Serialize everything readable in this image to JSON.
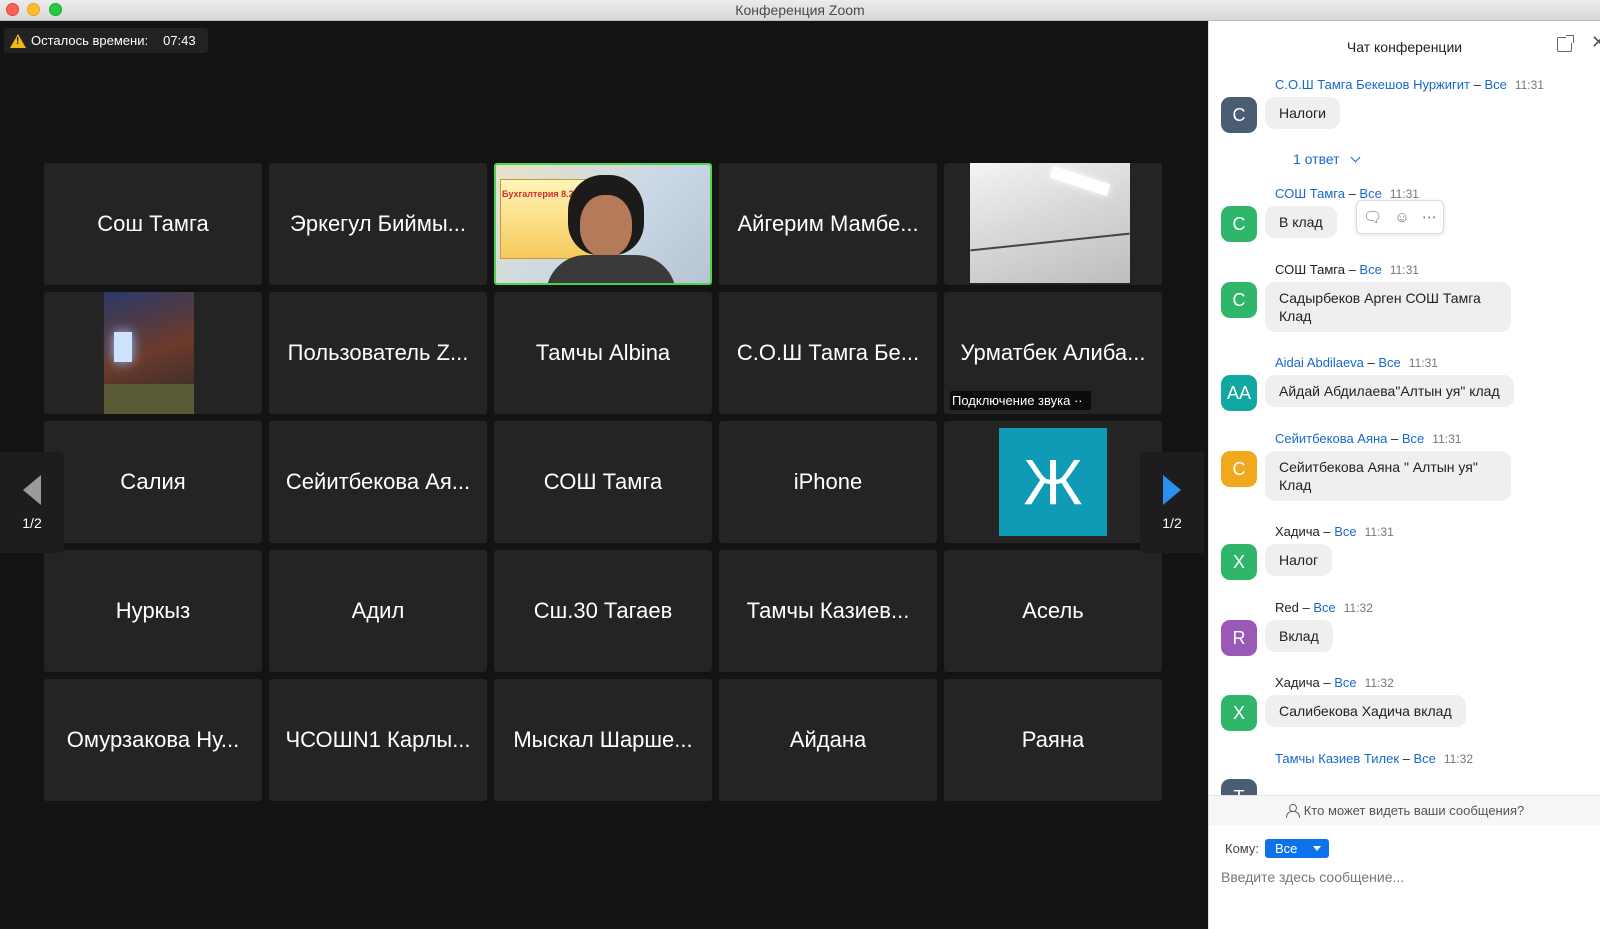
{
  "window": {
    "title": "Конференция Zoom"
  },
  "meeting": {
    "timer_label": "Осталось времени:",
    "timer_value": "07:43",
    "page_indicator": "1/2",
    "audio_status": "Подключение звука",
    "participants": [
      {
        "name": "Сош Тамга"
      },
      {
        "name": "Эркегул Биймы..."
      },
      {
        "name": ""
      },
      {
        "name": "Айгерим Мамбе..."
      },
      {
        "name": ""
      },
      {
        "name": ""
      },
      {
        "name": "Пользователь Z..."
      },
      {
        "name": "Тамчы Albina"
      },
      {
        "name": "С.О.Ш Тамга Бе..."
      },
      {
        "name": "Урматбек Алиба..."
      },
      {
        "name": "Салия"
      },
      {
        "name": "Сейитбекова Ая..."
      },
      {
        "name": "СОШ Тамга"
      },
      {
        "name": "iPhone"
      },
      {
        "name": ""
      },
      {
        "name": "Нуркыз"
      },
      {
        "name": "Адил"
      },
      {
        "name": "Сш.30 Тагаев"
      },
      {
        "name": "Тамчы   Казиев..."
      },
      {
        "name": "Асель"
      },
      {
        "name": "Омурзакова Ну..."
      },
      {
        "name": "ЧСОШN1 Карлы..."
      },
      {
        "name": "Мыскал Шарше..."
      },
      {
        "name": "Айдана"
      },
      {
        "name": "Раяна"
      }
    ],
    "avatar_letter": "Ж",
    "poster_text": "Бухгалтерия 8.2",
    "colors": {
      "active_border": "#4ed34e",
      "avatar_teal": "#0f9bb5",
      "next_arrow": "#2b8ff0"
    }
  },
  "chat": {
    "title": "Чат конференции",
    "messages": [
      {
        "initials": "С",
        "color": "#4b5d73",
        "sender": "С.О.Ш Тамга Бекешов Нуржигит",
        "to": "Все",
        "time": "11:31",
        "text": "Налоги",
        "reply": "1 ответ"
      },
      {
        "initials": "С",
        "color": "#2fb66b",
        "sender": "СОШ Тамга",
        "to": "Все",
        "time": "11:31",
        "text": "В клад"
      },
      {
        "initials": "С",
        "color": "#2fb66b",
        "sender": "СОШ Тамга",
        "to": "Все",
        "time": "11:31",
        "text": "Садырбеков Арген СОШ Тамга Клад"
      },
      {
        "initials": "АА",
        "color": "#12a7a0",
        "sender": "Aidai Abdilaeva",
        "to": "Все",
        "time": "11:31",
        "text": "Айдай Абдилаева\"Алтын уя\" клад"
      },
      {
        "initials": "С",
        "color": "#f2a81d",
        "sender": "Сейитбекова Аяна",
        "to": "Все",
        "time": "11:31",
        "text": "Сейитбекова Аяна \" Алтын уя\" Клад"
      },
      {
        "initials": "Х",
        "color": "#2fb66b",
        "sender": "Хадича",
        "to": "Все",
        "time": "11:31",
        "text": "Налог"
      },
      {
        "initials": "R",
        "color": "#9b59b6",
        "sender": "Red",
        "to": "Все",
        "time": "11:32",
        "text": "Вклад"
      },
      {
        "initials": "Х",
        "color": "#2fb66b",
        "sender": "Хадича",
        "to": "Все",
        "time": "11:32",
        "text": "Салибекова Хадича вклад"
      },
      {
        "initials": "Т",
        "color": "#4b5d73",
        "sender": "Тамчы    Казиев Тилек",
        "to": "Все",
        "time": "11:32",
        "text": ""
      }
    ],
    "hover_tools": [
      "reply-icon",
      "emoji-icon",
      "more-icon"
    ],
    "visibility_text": "Кто может видеть ваши сообщения?",
    "to_label": "Кому:",
    "to_value": "Все",
    "input_placeholder": "Введите здесь сообщение..."
  }
}
